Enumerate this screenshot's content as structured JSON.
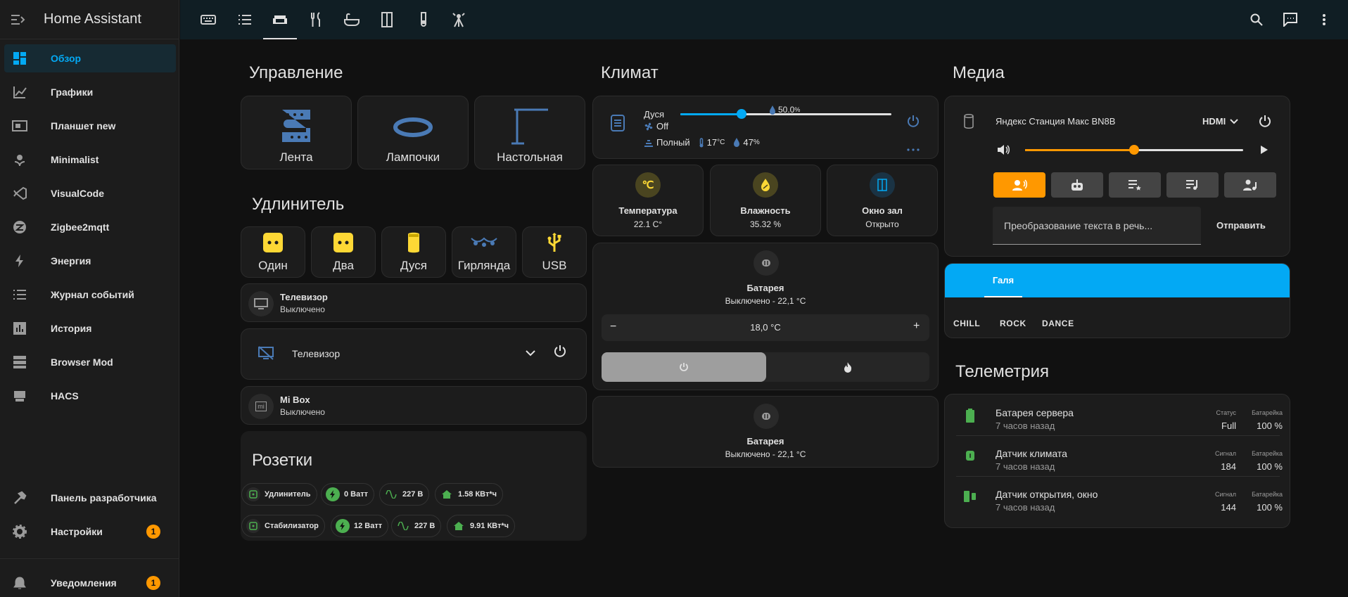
{
  "app": {
    "title": "Home Assistant"
  },
  "sidebar": {
    "items": [
      {
        "label": "Обзор",
        "icon": "dashboard-icon"
      },
      {
        "label": "Графики",
        "icon": "chart-line-icon"
      },
      {
        "label": "Планшет new",
        "icon": "tablet-icon"
      },
      {
        "label": "Minimalist",
        "icon": "flower-icon"
      },
      {
        "label": "VisualCode",
        "icon": "vscode-icon"
      },
      {
        "label": "Zigbee2mqtt",
        "icon": "zigbee-icon"
      },
      {
        "label": "Энергия",
        "icon": "lightning-bolt-icon"
      },
      {
        "label": "Журнал событий",
        "icon": "format-list-icon"
      },
      {
        "label": "История",
        "icon": "chart-box-icon"
      },
      {
        "label": "Browser Mod",
        "icon": "server-icon"
      },
      {
        "label": "HACS",
        "icon": "hacs-icon"
      }
    ],
    "developer": "Панель разработчика",
    "settings": "Настройки",
    "settings_badge": "1",
    "notifications": "Уведомления",
    "notifications_badge": "1"
  },
  "topbar": {
    "tabs": [
      "keyboard-icon",
      "list-icon",
      "sofa-icon",
      "fork-knife-icon",
      "bathtub-icon",
      "wardrobe-icon",
      "flask-icon",
      "antenna-icon"
    ],
    "active_tab": 2,
    "right": [
      "search-icon",
      "assist-icon",
      "more-vert-icon"
    ]
  },
  "control": {
    "title": "Управление",
    "buttons": [
      "Лента",
      "Лампочки",
      "Настольная"
    ]
  },
  "extender": {
    "title": "Удлинитель",
    "buttons": [
      "Один",
      "Два",
      "Дуся",
      "Гирлянда",
      "USB"
    ]
  },
  "tv1": {
    "name": "Телевизор",
    "state": "Выключено"
  },
  "tv2": {
    "name": "Телевизор"
  },
  "mibox": {
    "name": "Mi Box",
    "state": "Выключено",
    "icon_text": "mi"
  },
  "sockets": {
    "title": "Розетки",
    "rows": [
      {
        "name": "Удлинитель",
        "power": "0 Ватт",
        "voltage": "227 В",
        "energy": "1.58 КВт*ч"
      },
      {
        "name": "Стабилизатор",
        "power": "12 Ватт",
        "voltage": "227 В",
        "energy": "9.91 КВт*ч"
      }
    ]
  },
  "climate": {
    "title": "Климат",
    "humidifier": {
      "name": "Дуся",
      "fan": "Off",
      "level": "50.0",
      "level_unit": "%",
      "mode": "Полный",
      "temp": "17",
      "temp_unit": "°C",
      "hum": "47",
      "hum_unit": "%",
      "slider_value": 0.5
    },
    "tiles": [
      {
        "name": "Температура",
        "value": "22.1 C°"
      },
      {
        "name": "Влажность",
        "value": "35.32 %"
      },
      {
        "name": "Окно зал",
        "value": "Открыто"
      }
    ],
    "battery1": {
      "name": "Батарея",
      "state": "Выключено - 22,1 °C",
      "target": "18,0 °C",
      "minus": "−",
      "plus": "+"
    },
    "battery2": {
      "name": "Батарея",
      "state": "Выключено - 22,1 °C"
    }
  },
  "media": {
    "title": "Медиа",
    "player": {
      "name": "Яндекс Станция Макс BN8B",
      "source": "HDMI",
      "volume": 0.5,
      "tts_placeholder": "Преобразование текста в речь...",
      "send": "Отправить"
    },
    "tabs": {
      "active": "Галя",
      "chips": [
        "CHILL",
        "ROCK",
        "DANCE"
      ]
    }
  },
  "telemetry": {
    "title": "Телеметрия",
    "rows": [
      {
        "name": "Батарея сервера",
        "time": "7 часов назад",
        "c1_label": "Статус",
        "c1_value": "Full",
        "c2_label": "Батарейка",
        "c2_value": "100 %"
      },
      {
        "name": "Датчик климата",
        "time": "7 часов назад",
        "c1_label": "Сигнал",
        "c1_value": "184",
        "c2_label": "Батарейка",
        "c2_value": "100 %"
      },
      {
        "name": "Датчик открытия, окно",
        "time": "7 часов назад",
        "c1_label": "Сигнал",
        "c1_value": "144",
        "c2_label": "Батарейка",
        "c2_value": "100 %"
      }
    ]
  },
  "colors": {
    "accent": "#03a9f4",
    "orange": "#ff9800",
    "green": "#4caf50",
    "blue_icon": "#4a7ab5",
    "yellow": "#fdd835"
  }
}
